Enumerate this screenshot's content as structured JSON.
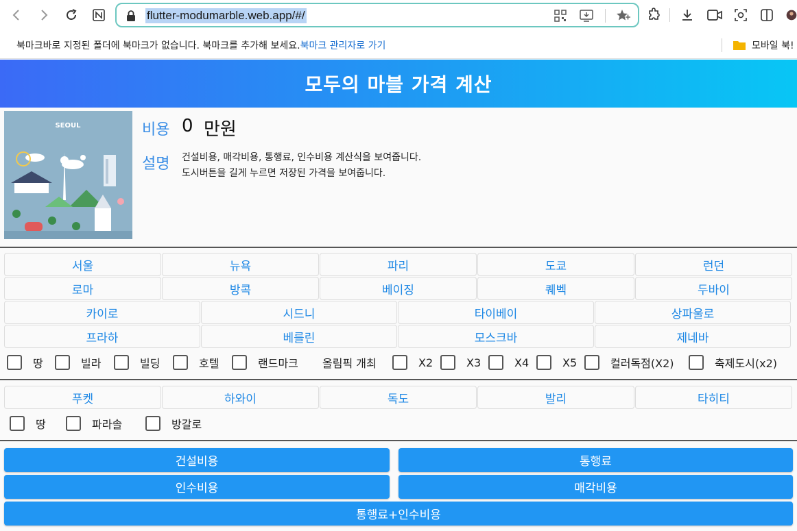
{
  "browser": {
    "url": "flutter-modumarble.web.app/#/",
    "bookmarks_bar": {
      "message": "북마크바로 지정된 폴더에 북마크가 없습니다. 북마크를 추가해 보세요.",
      "link": "북마크 관리자로 가기",
      "folder_label": "모바일 북!"
    }
  },
  "app": {
    "title": "모두의 마블 가격 계산",
    "image_caption": "SEOUL",
    "cost_label": "비용",
    "cost_value": "0",
    "cost_unit": "만원",
    "desc_label": "설명",
    "desc_line1": "건설비용, 매각비용, 통행료, 인수비용 계산식을 보여줍니다.",
    "desc_line2": "도시버튼을 길게 누르면 저장된 가격을 보여줍니다."
  },
  "cities_row1": [
    "서울",
    "뉴욕",
    "파리",
    "도쿄",
    "런던"
  ],
  "cities_row2": [
    "로마",
    "방콕",
    "베이징",
    "퀘벡",
    "두바이"
  ],
  "cities_row3": [
    "카이로",
    "시드니",
    "타이베이",
    "상파울로"
  ],
  "cities_row4": [
    "프라하",
    "베를린",
    "모스크바",
    "제네바"
  ],
  "building_options": [
    "땅",
    "빌라",
    "빌딩",
    "호텔",
    "랜드마크"
  ],
  "olympic_label": "올림픽 개최",
  "olympic_options": [
    "X2",
    "X3",
    "X4",
    "X5"
  ],
  "extra_options": [
    "컬러독점(X2)",
    "축제도시(x2)"
  ],
  "tourist_spots": [
    "푸켓",
    "하와이",
    "독도",
    "발리",
    "타히티"
  ],
  "tourist_options": [
    "땅",
    "파라솔",
    "방갈로"
  ],
  "actions": {
    "construction": "건설비용",
    "toll": "통행료",
    "acquisition": "인수비용",
    "sale": "매각비용",
    "toll_plus_acquisition": "통행료+인수비용"
  },
  "colors": {
    "appbar_start": "#3b6af6",
    "appbar_end": "#08c6f5",
    "accent": "#2196f3",
    "city_text": "#1e88e5"
  }
}
